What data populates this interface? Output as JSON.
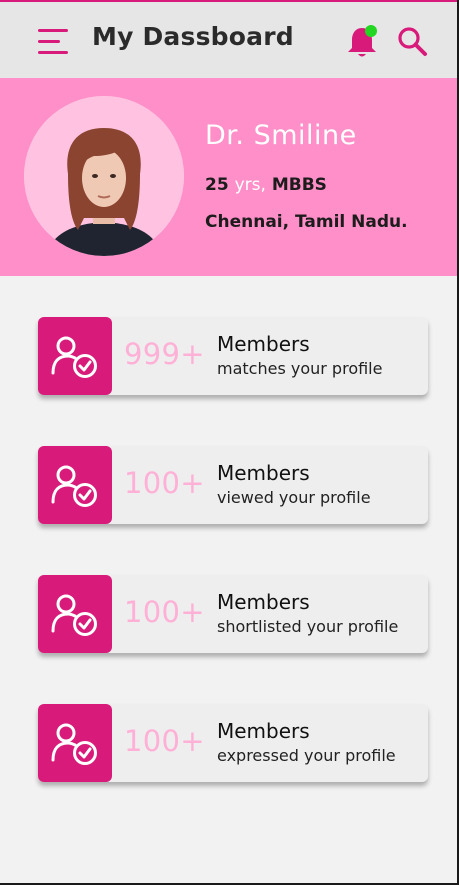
{
  "header": {
    "title": "My Dassboard",
    "menu_icon": "hamburger-menu-icon",
    "notification_icon": "bell-icon",
    "notification_dot_color": "#22d622",
    "search_icon": "search-icon"
  },
  "profile": {
    "name": "Dr. Smiline",
    "age": "25",
    "age_unit": "yrs,",
    "degree": "MBBS",
    "location": "Chennai, Tamil Nadu.",
    "avatar_icon": "profile-photo"
  },
  "stats": [
    {
      "count": "999+",
      "title": "Members",
      "subtitle": "matches your profile",
      "icon": "user-verified-icon"
    },
    {
      "count": "100+",
      "title": "Members",
      "subtitle": "viewed your profile",
      "icon": "user-verified-icon"
    },
    {
      "count": "100+",
      "title": "Members",
      "subtitle": "shortlisted your profile",
      "icon": "user-verified-icon"
    },
    {
      "count": "100+",
      "title": "Members",
      "subtitle": "expressed your profile",
      "icon": "user-verified-icon"
    }
  ],
  "colors": {
    "accent": "#d81b7a",
    "profile_bg": "#ff8fc8",
    "count_text": "#ffb0d6",
    "header_bg": "#e6e6e6",
    "page_bg": "#f2f2f2"
  }
}
